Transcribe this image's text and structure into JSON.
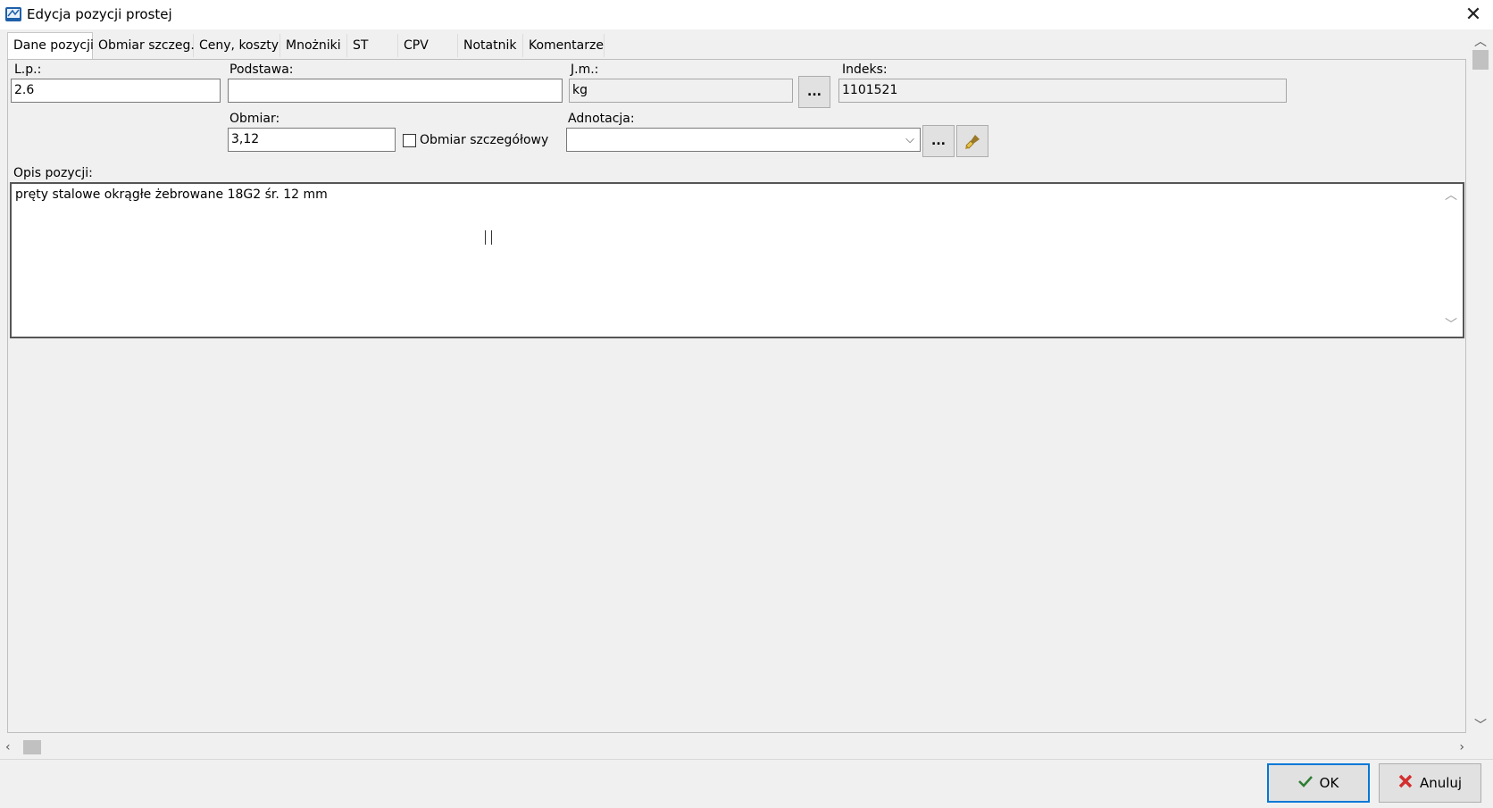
{
  "window": {
    "title": "Edycja pozycji prostej"
  },
  "tabs": [
    {
      "label": "Dane pozycji"
    },
    {
      "label": "Obmiar szczeg."
    },
    {
      "label": "Ceny, koszty"
    },
    {
      "label": "Mnożniki"
    },
    {
      "label": "ST"
    },
    {
      "label": "CPV"
    },
    {
      "label": "Notatnik"
    },
    {
      "label": "Komentarze"
    }
  ],
  "form": {
    "lp_label": "L.p.:",
    "lp_value": "2.6",
    "podstawa_label": "Podstawa:",
    "podstawa_value": "",
    "jm_label": "J.m.:",
    "jm_value": "kg",
    "jm_button": "...",
    "indeks_label": "Indeks:",
    "indeks_value": "1101521",
    "obmiar_label": "Obmiar:",
    "obmiar_value": "3,12",
    "obmiar_szczegolowy_label": "Obmiar szczegółowy",
    "obmiar_szczegolowy_checked": false,
    "adnotacja_label": "Adnotacja:",
    "adnotacja_value": "",
    "adnotacja_button": "...",
    "opis_label": "Opis pozycji:",
    "opis_value": "pręty stalowe okrągłe żebrowane 18G2 śr. 12 mm"
  },
  "buttons": {
    "ok_label": "OK",
    "cancel_label": "Anuluj"
  },
  "colors": {
    "ok_check": "#2e7d32",
    "cancel_x": "#d32f2f",
    "ok_border": "#0078d7"
  }
}
